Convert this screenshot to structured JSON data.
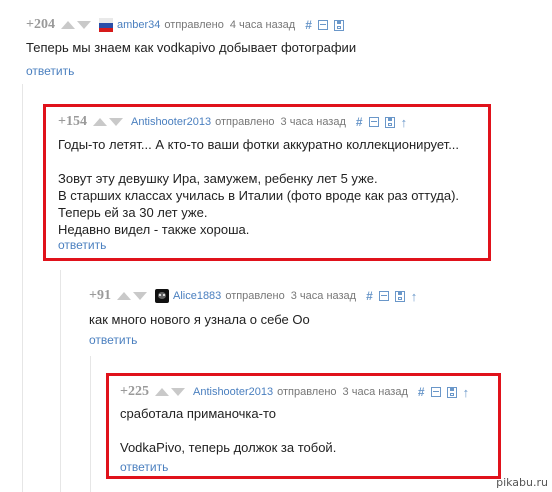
{
  "comments": [
    {
      "rating": "+204",
      "author": "amber34",
      "verb": "отправлено",
      "time": "4 часа назад",
      "lines": [
        "Теперь мы знаем как vodkapivo добывает фотографии"
      ],
      "reply": "ответить"
    },
    {
      "rating": "+154",
      "author": "Antishooter2013",
      "verb": "отправлено",
      "time": "3 часа назад",
      "lines": [
        "Годы-то летят... А кто-то ваши фотки аккуратно коллекционирует...",
        "",
        "Зовут эту девушку Ира, замужем, ребенку лет 5 уже.",
        "В старших классах училась в Италии (фото вроде как раз оттуда).",
        "Теперь ей за 30 лет уже.",
        "Недавно видел - также хороша."
      ],
      "reply": "ответить"
    },
    {
      "rating": "+91",
      "author": "Alice1883",
      "verb": "отправлено",
      "time": "3 часа назад",
      "lines": [
        "как много нового я узнала о себе Оо"
      ],
      "reply": "ответить"
    },
    {
      "rating": "+225",
      "author": "Antishooter2013",
      "verb": "отправлено",
      "time": "3 часа назад",
      "lines": [
        "сработала приманочка-то",
        "",
        "VodkaPivo, теперь должок за тобой."
      ],
      "reply": "ответить"
    }
  ],
  "icons": {
    "link": "hash-icon",
    "collapse": "collapse-icon",
    "save": "save-icon",
    "parent": "arrow-up-icon",
    "vote_up": "vote-up-icon",
    "vote_down": "vote-down-icon"
  },
  "colors": {
    "highlight_frame": "#e0121b",
    "link": "#4a7fbf",
    "meta": "#999999"
  },
  "watermark": "pikabu.ru"
}
